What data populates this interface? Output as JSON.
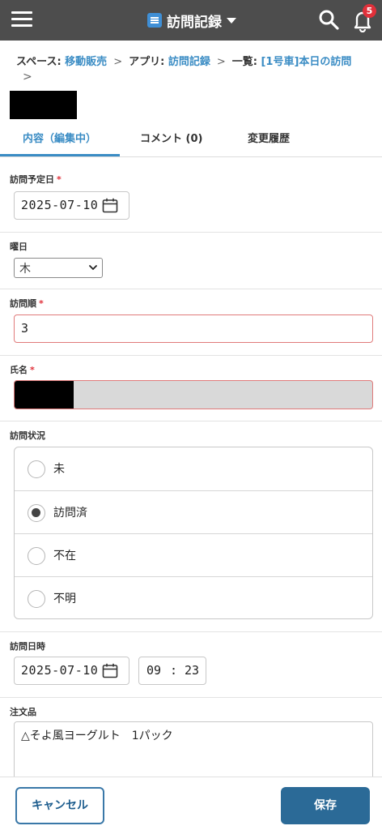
{
  "header": {
    "app_title": "訪問記録",
    "notification_count": "5"
  },
  "breadcrumb": {
    "space_label": "スペース:",
    "space_name": "移動販売",
    "app_label": "アプリ:",
    "app_name": "訪問記録",
    "list_label": "一覧:",
    "list_name": "[1号車]本日の訪問",
    "separator": ">"
  },
  "tabs": [
    {
      "label": "内容（編集中）",
      "active": true
    },
    {
      "label": "コメント (0)",
      "active": false
    },
    {
      "label": "変更履歴",
      "active": false
    }
  ],
  "fields": {
    "visit_date": {
      "label": "訪問予定日",
      "required": "*",
      "value": "2025-07-10"
    },
    "weekday": {
      "label": "曜日",
      "value": "木"
    },
    "visit_order": {
      "label": "訪問順",
      "required": "*",
      "value": "3"
    },
    "name": {
      "label": "氏名",
      "required": "*"
    },
    "visit_status": {
      "label": "訪問状況",
      "options": [
        "未",
        "訪問済",
        "不在",
        "不明"
      ],
      "selected": "訪問済"
    },
    "visit_datetime": {
      "label": "訪問日時",
      "date": "2025-07-10",
      "hour": "09",
      "colon": ":",
      "minute": "23"
    },
    "order_items": {
      "label": "注文品",
      "value": "△そよ風ヨーグルト　1パック"
    }
  },
  "footer": {
    "cancel_label": "キャンセル",
    "save_label": "保存"
  },
  "colors": {
    "accent": "#3a8cc4",
    "topbar": "#4d4d4d",
    "save_button": "#2b6a97",
    "required": "#e0303a",
    "badge": "#e0303a"
  }
}
